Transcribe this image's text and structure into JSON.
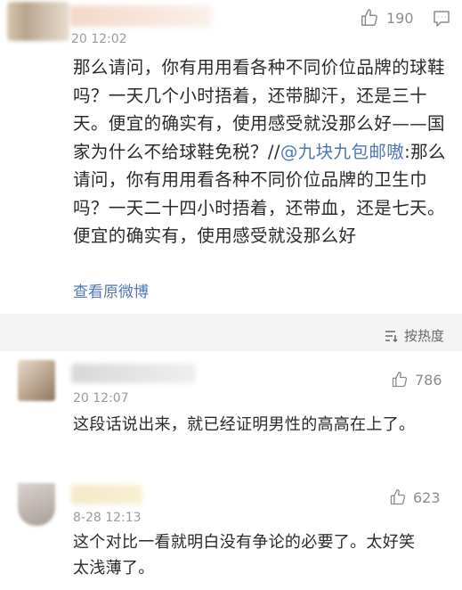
{
  "post": {
    "timestamp": "20 12:02",
    "like_count": "190",
    "text_before_mention": "那么请问，你有用用看各种不同价位品牌的球鞋吗？一天几个小时捂着，还带脚汗，还是三十天。便宜的确实有，使用感受就没那么好——国家为什么不给球鞋免税？//",
    "mention": "@九块九包邮嗷",
    "text_after_mention": ":那么请问，你有用用看各种不同价位品牌的卫生巾吗？一天二十四小时捂着，还带血，还是七天。便宜的确实有，使用感受就没那么好",
    "view_original": "查看原微博"
  },
  "sort": {
    "label": "按热度"
  },
  "comments": [
    {
      "timestamp": "20 12:07",
      "like_count": "786",
      "text": "这段话说出来，就已经证明男性的高高在上了。"
    },
    {
      "timestamp": "8-28 12:13",
      "like_count": "623",
      "text": "这个对比一看就明白没有争论的必要了。太好笑太浅薄了。"
    }
  ],
  "colors": {
    "link": "#4e77b5",
    "meta": "#9a9a9a",
    "band": "#f4f4f4"
  },
  "icons": [
    "thumbs-up-icon",
    "comment-icon",
    "sort-icon"
  ]
}
